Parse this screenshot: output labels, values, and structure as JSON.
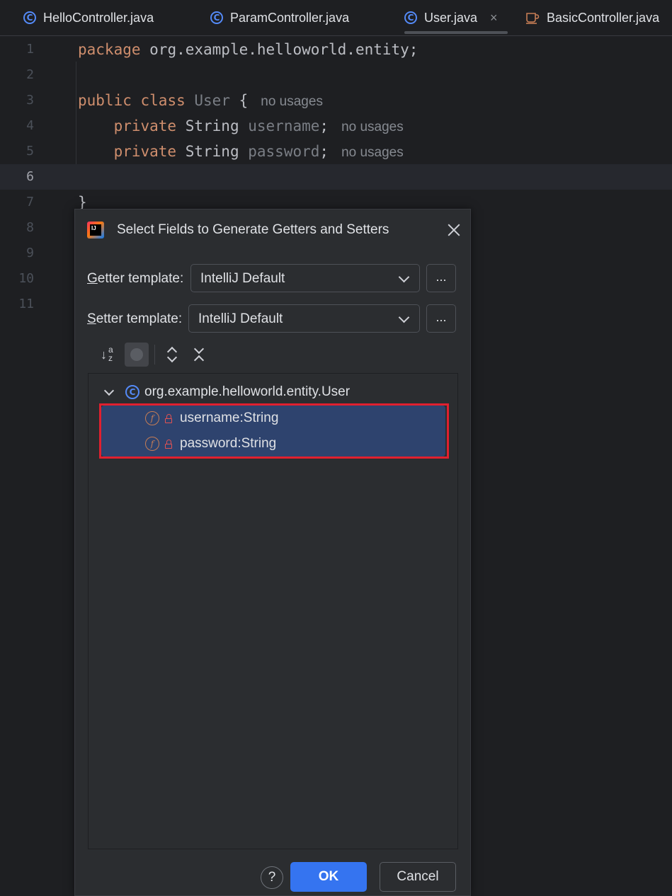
{
  "tabs": [
    {
      "label": "HelloController.java",
      "icon": "class-icon"
    },
    {
      "label": "ParamController.java",
      "icon": "class-icon"
    },
    {
      "label": "User.java",
      "icon": "class-icon",
      "active": true,
      "close": "×"
    },
    {
      "label": "BasicController.java",
      "icon": "coffee-cup-icon"
    }
  ],
  "editor": {
    "line_numbers": [
      "1",
      "2",
      "3",
      "4",
      "5",
      "6",
      "7",
      "8",
      "9",
      "10",
      "11"
    ],
    "current_line": "6",
    "code": {
      "line1_kw": "package",
      "line1_rest": " org.example.helloworld.entity;",
      "line3_kw1": "public",
      "line3_kw2": "class",
      "line3_name": "User",
      "line3_brace": " {",
      "line4_kw": "private",
      "line4_type": " String ",
      "line4_name": "username",
      "line4_semi": ";",
      "line5_kw": "private",
      "line5_type": " String ",
      "line5_name": "password",
      "line5_semi": ";",
      "line7": "}",
      "hint": "no usages"
    }
  },
  "dialog": {
    "title": "Select Fields to Generate Getters and Setters",
    "getter_label_first": "G",
    "getter_label_rest": "etter template:",
    "getter_value": "IntelliJ Default",
    "setter_label_first": "S",
    "setter_label_rest": "etter template:",
    "setter_value": "IntelliJ Default",
    "more_button": "...",
    "tree": {
      "root": "org.example.helloworld.entity.User",
      "fields": [
        "username:String",
        "password:String"
      ]
    },
    "help": "?",
    "ok": "OK",
    "cancel": "Cancel"
  },
  "colors": {
    "keyword": "#cf8e6d",
    "selection": "#2e436e",
    "highlight_box": "#e0202f",
    "primary_button": "#3574f0"
  }
}
